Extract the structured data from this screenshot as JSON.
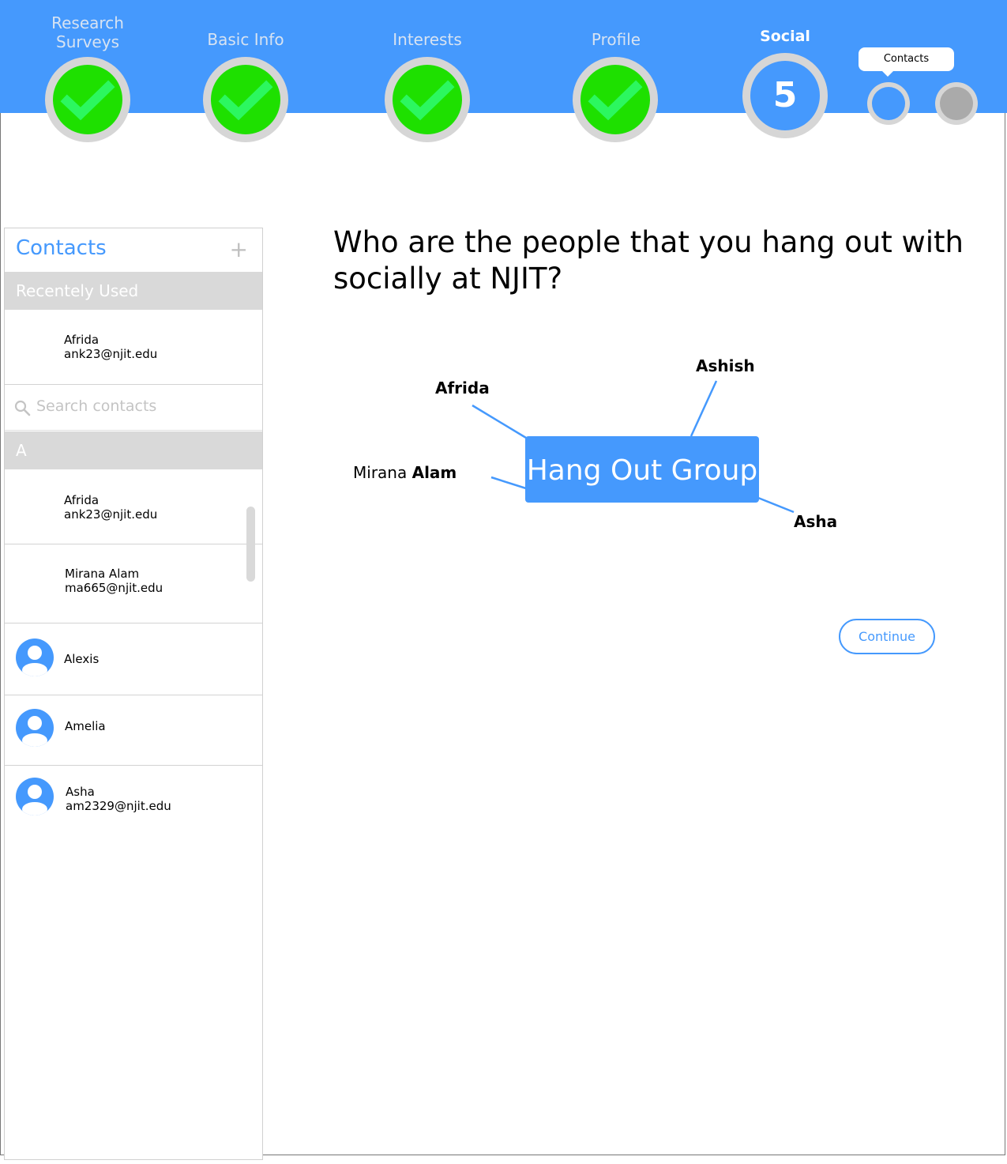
{
  "steps": [
    {
      "label_line1": "Research",
      "label_line2": "Surveys",
      "status": "complete"
    },
    {
      "label": "Basic Info",
      "status": "complete"
    },
    {
      "label": "Interests",
      "status": "complete"
    },
    {
      "label": "Profile",
      "status": "complete"
    },
    {
      "label": "Social",
      "number": "5",
      "status": "current"
    }
  ],
  "tooltip": {
    "label": "Contacts"
  },
  "sidebar": {
    "title": "Contacts",
    "add_symbol": "+",
    "recent_header": "Recentely Used",
    "recent": [
      {
        "name": "Afrida",
        "email": "ank23@njit.edu"
      }
    ],
    "search_placeholder": "Search contacts",
    "group_letter": "A",
    "contacts": [
      {
        "name": "Afrida",
        "email": "ank23@njit.edu"
      },
      {
        "name": "Mirana Alam",
        "email": "ma665@njit.edu"
      },
      {
        "name": "Alexis"
      },
      {
        "name": "Amelia"
      },
      {
        "name": "Asha",
        "email": "am2329@njit.edu"
      }
    ]
  },
  "main": {
    "question": "Who are the people that you hang out with socially at NJIT?",
    "group_name": "Hang Out Group",
    "members": {
      "afrida": "Afrida",
      "ashish": "Ashish",
      "mirana_first": "Mirana",
      "mirana_last": "Alam",
      "asha": "Asha"
    },
    "continue_label": "Continue"
  },
  "colors": {
    "accent": "#4599fd",
    "complete": "#1ee000",
    "check": "#2cf760",
    "ring": "#d6d6d6"
  }
}
